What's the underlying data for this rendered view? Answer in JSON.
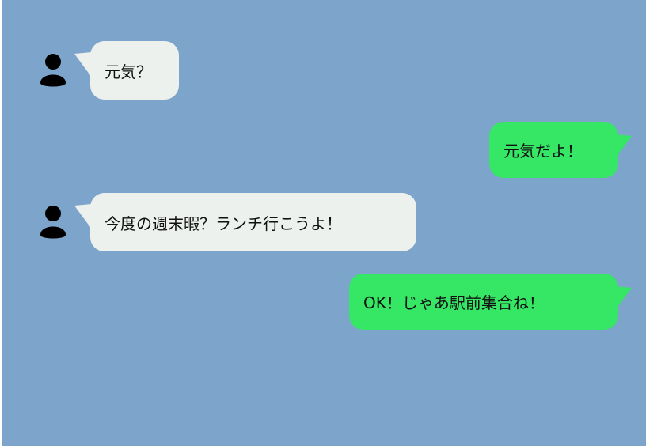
{
  "colors": {
    "background": "#7da4cb",
    "incoming": "#edf1ee",
    "outgoing": "#35e765"
  },
  "messages": [
    {
      "side": "incoming",
      "avatar": "user-silhouette-icon",
      "text": "元気？"
    },
    {
      "side": "outgoing",
      "text": "元気だよ！"
    },
    {
      "side": "incoming",
      "avatar": "user-silhouette-icon",
      "text": "今度の週末暇？ランチ行こうよ！"
    },
    {
      "side": "outgoing",
      "text": "OK！じゃあ駅前集合ね！"
    }
  ]
}
